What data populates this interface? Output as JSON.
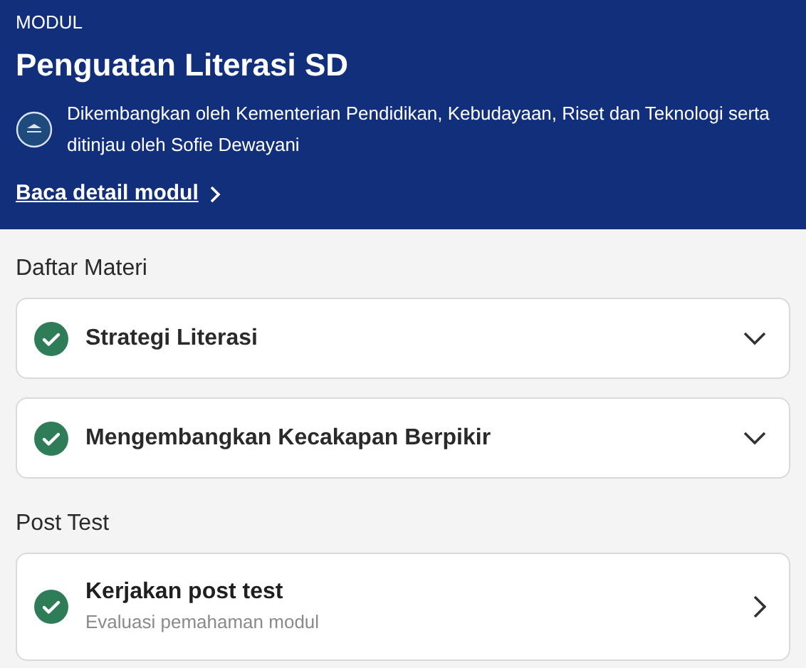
{
  "header": {
    "label": "MODUL",
    "title": "Penguatan Literasi SD",
    "description": "Dikembangkan oleh Kementerian Pendidikan, Kebudayaan, Riset dan Teknologi serta ditinjau oleh Sofie Dewayani",
    "link": "Baca detail modul"
  },
  "materials": {
    "heading": "Daftar Materi",
    "items": [
      {
        "title": "Strategi Literasi",
        "completed": true,
        "expanded": false
      },
      {
        "title": "Mengembangkan Kecakapan Berpikir",
        "completed": true,
        "expanded": false
      }
    ]
  },
  "post_test": {
    "heading": "Post Test",
    "title": "Kerjakan post test",
    "subtitle": "Evaluasi pemahaman modul",
    "completed": true
  }
}
